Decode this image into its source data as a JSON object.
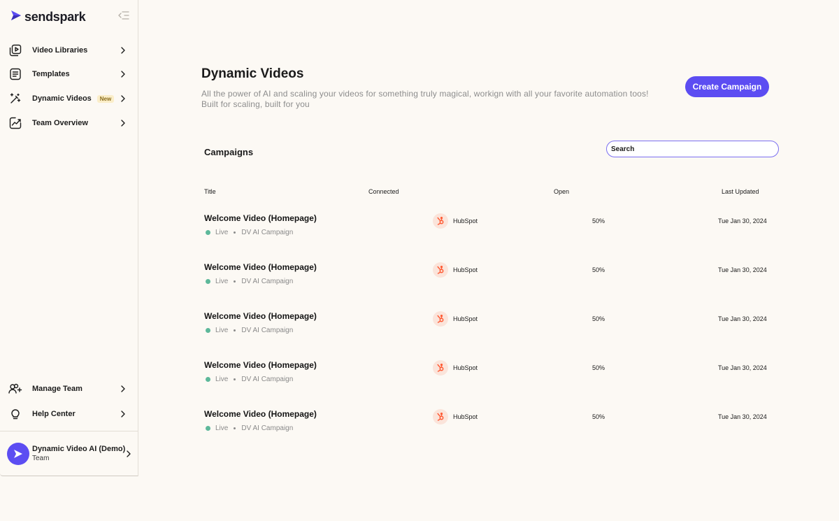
{
  "brand": {
    "name": "sendspark"
  },
  "sidebar": {
    "items": [
      {
        "label": "Video Libraries",
        "icon": "video-library-icon"
      },
      {
        "label": "Templates",
        "icon": "templates-icon"
      },
      {
        "label": "Dynamic Videos",
        "icon": "magic-wand-icon",
        "badge": "New"
      },
      {
        "label": "Team Overview",
        "icon": "chart-icon"
      }
    ],
    "bottom_items": [
      {
        "label": "Manage Team",
        "icon": "add-users-icon"
      },
      {
        "label": "Help Center",
        "icon": "lightbulb-icon"
      }
    ],
    "team": {
      "name": "Dynamic Video AI (Demo)",
      "subtitle": "Team"
    }
  },
  "main": {
    "title": "Dynamic Videos",
    "description": "All the power of AI and scaling your videos for something truly magical, workign with all your favorite automation toos! Built for scaling, built for you",
    "create_button": "Create Campaign",
    "section_title": "Campaigns",
    "search": {
      "placeholder": "Search",
      "value": ""
    },
    "columns": [
      "Title",
      "Connected",
      "Open",
      "Last Updated"
    ],
    "rows": [
      {
        "title": "Welcome Video (Homepage)",
        "status": "Live",
        "type": "DV AI Campaign",
        "connected": "HubSpot",
        "open": "50%",
        "updated": "Tue Jan 30, 2024"
      },
      {
        "title": "Welcome Video (Homepage)",
        "status": "Live",
        "type": "DV AI Campaign",
        "connected": "HubSpot",
        "open": "50%",
        "updated": "Tue Jan 30, 2024"
      },
      {
        "title": "Welcome Video (Homepage)",
        "status": "Live",
        "type": "DV AI Campaign",
        "connected": "HubSpot",
        "open": "50%",
        "updated": "Tue Jan 30, 2024"
      },
      {
        "title": "Welcome Video (Homepage)",
        "status": "Live",
        "type": "DV AI Campaign",
        "connected": "HubSpot",
        "open": "50%",
        "updated": "Tue Jan 30, 2024"
      },
      {
        "title": "Welcome Video (Homepage)",
        "status": "Live",
        "type": "DV AI Campaign",
        "connected": "HubSpot",
        "open": "50%",
        "updated": "Tue Jan 30, 2024"
      }
    ]
  },
  "colors": {
    "accent": "#5c4df2",
    "background": "#fcf9f4",
    "live": "#5db89a",
    "hubspot": "#ff5c35"
  }
}
